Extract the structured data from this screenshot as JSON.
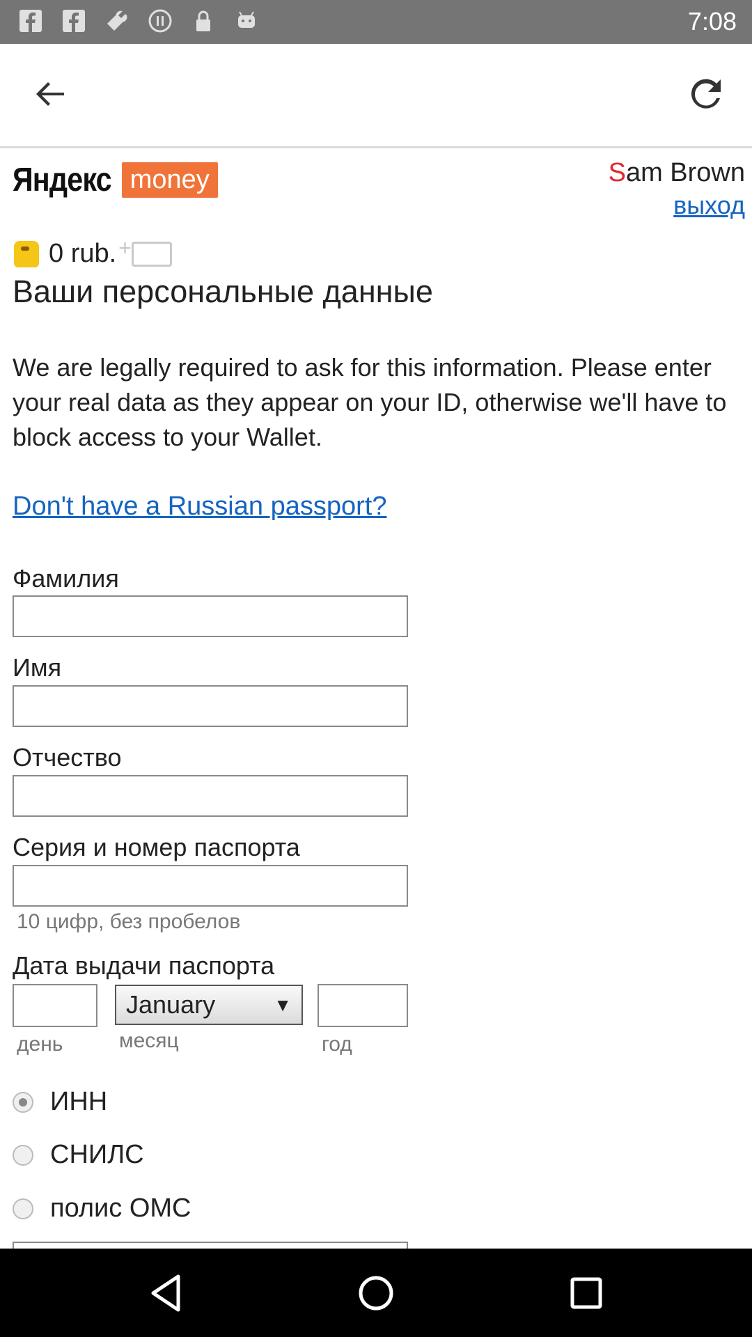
{
  "status_bar": {
    "time": "7:08",
    "icons": [
      "facebook-icon",
      "facebook-icon",
      "wrench-icon",
      "pause-circle-icon",
      "lock-icon",
      "android-icon"
    ]
  },
  "toolbar": {
    "back_icon": "arrow-left-icon",
    "reload_icon": "refresh-icon"
  },
  "header": {
    "logo_text": "Яндекс",
    "logo_money": "money",
    "user_first_letter": "S",
    "user_rest": "am Brown",
    "logout_label": "выход"
  },
  "balance": {
    "amount": "0 rub."
  },
  "page": {
    "title": "Ваши персональные данные",
    "intro": "We are legally required to ask for this information. Please enter your real data as they appear on your ID, otherwise we'll have to block access to your Wallet.",
    "passport_link": "Don't have a Russian passport?"
  },
  "form": {
    "surname_label": "Фамилия",
    "name_label": "Имя",
    "patronymic_label": "Отчество",
    "passport_label": "Серия и номер паспорта",
    "passport_hint": "10 цифр, без пробелов",
    "issue_date_label": "Дата выдачи паспорта",
    "month_value": "January",
    "day_hint": "день",
    "month_hint": "месяц",
    "year_hint": "год",
    "radio_options": [
      {
        "label": "ИНН",
        "checked": true
      },
      {
        "label": "СНИЛС",
        "checked": false
      },
      {
        "label": "полис ОМС",
        "checked": false
      }
    ]
  },
  "nav_bar": {
    "icons": [
      "back-triangle-icon",
      "home-circle-icon",
      "recent-square-icon"
    ]
  },
  "colors": {
    "accent_orange": "#f0743a",
    "link_blue": "#1565c0",
    "brand_red": "#e0272f",
    "status_bar": "#757575"
  }
}
